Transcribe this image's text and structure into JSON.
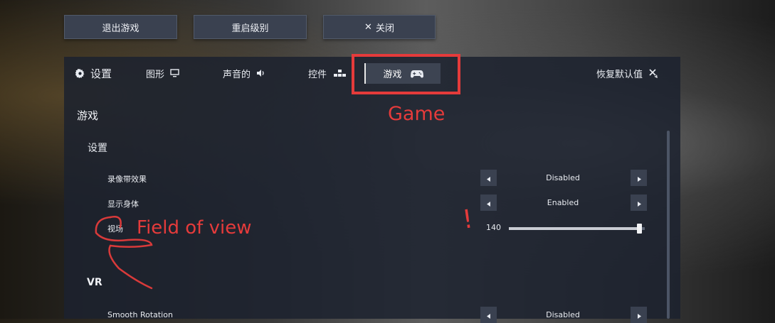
{
  "top_buttons": {
    "quit": "退出游戏",
    "restart": "重启级别",
    "close": "关闭"
  },
  "tabs": {
    "settings_title": "设置",
    "graphics": "图形",
    "audio": "声音的",
    "controls": "控件",
    "game": "游戏",
    "restore_defaults": "恢复默认值"
  },
  "content": {
    "section_title": "游戏",
    "subsection_title": "设置",
    "rows": [
      {
        "label": "录像带效果",
        "value": "Disabled"
      },
      {
        "label": "显示身体",
        "value": "Enabled"
      },
      {
        "label": "视场",
        "value": "140",
        "slider_fraction": 0.98
      }
    ],
    "vr_title": "VR",
    "vr_rows": [
      {
        "label": "Smooth Rotation",
        "value": "Disabled"
      }
    ]
  },
  "annotations": {
    "game": "Game",
    "field_of_view": "Field of view",
    "exclamation": "!"
  },
  "colors": {
    "annotation_red": "#e53b3b",
    "panel_bg": "#1c222e",
    "button_bg": "#3a4150"
  },
  "icons": [
    "gear-icon",
    "monitor-icon",
    "speaker-icon",
    "controls-blocks-icon",
    "gamepad-icon",
    "reset-icon",
    "close-x-icon",
    "arrow-left-icon",
    "arrow-right-icon"
  ]
}
